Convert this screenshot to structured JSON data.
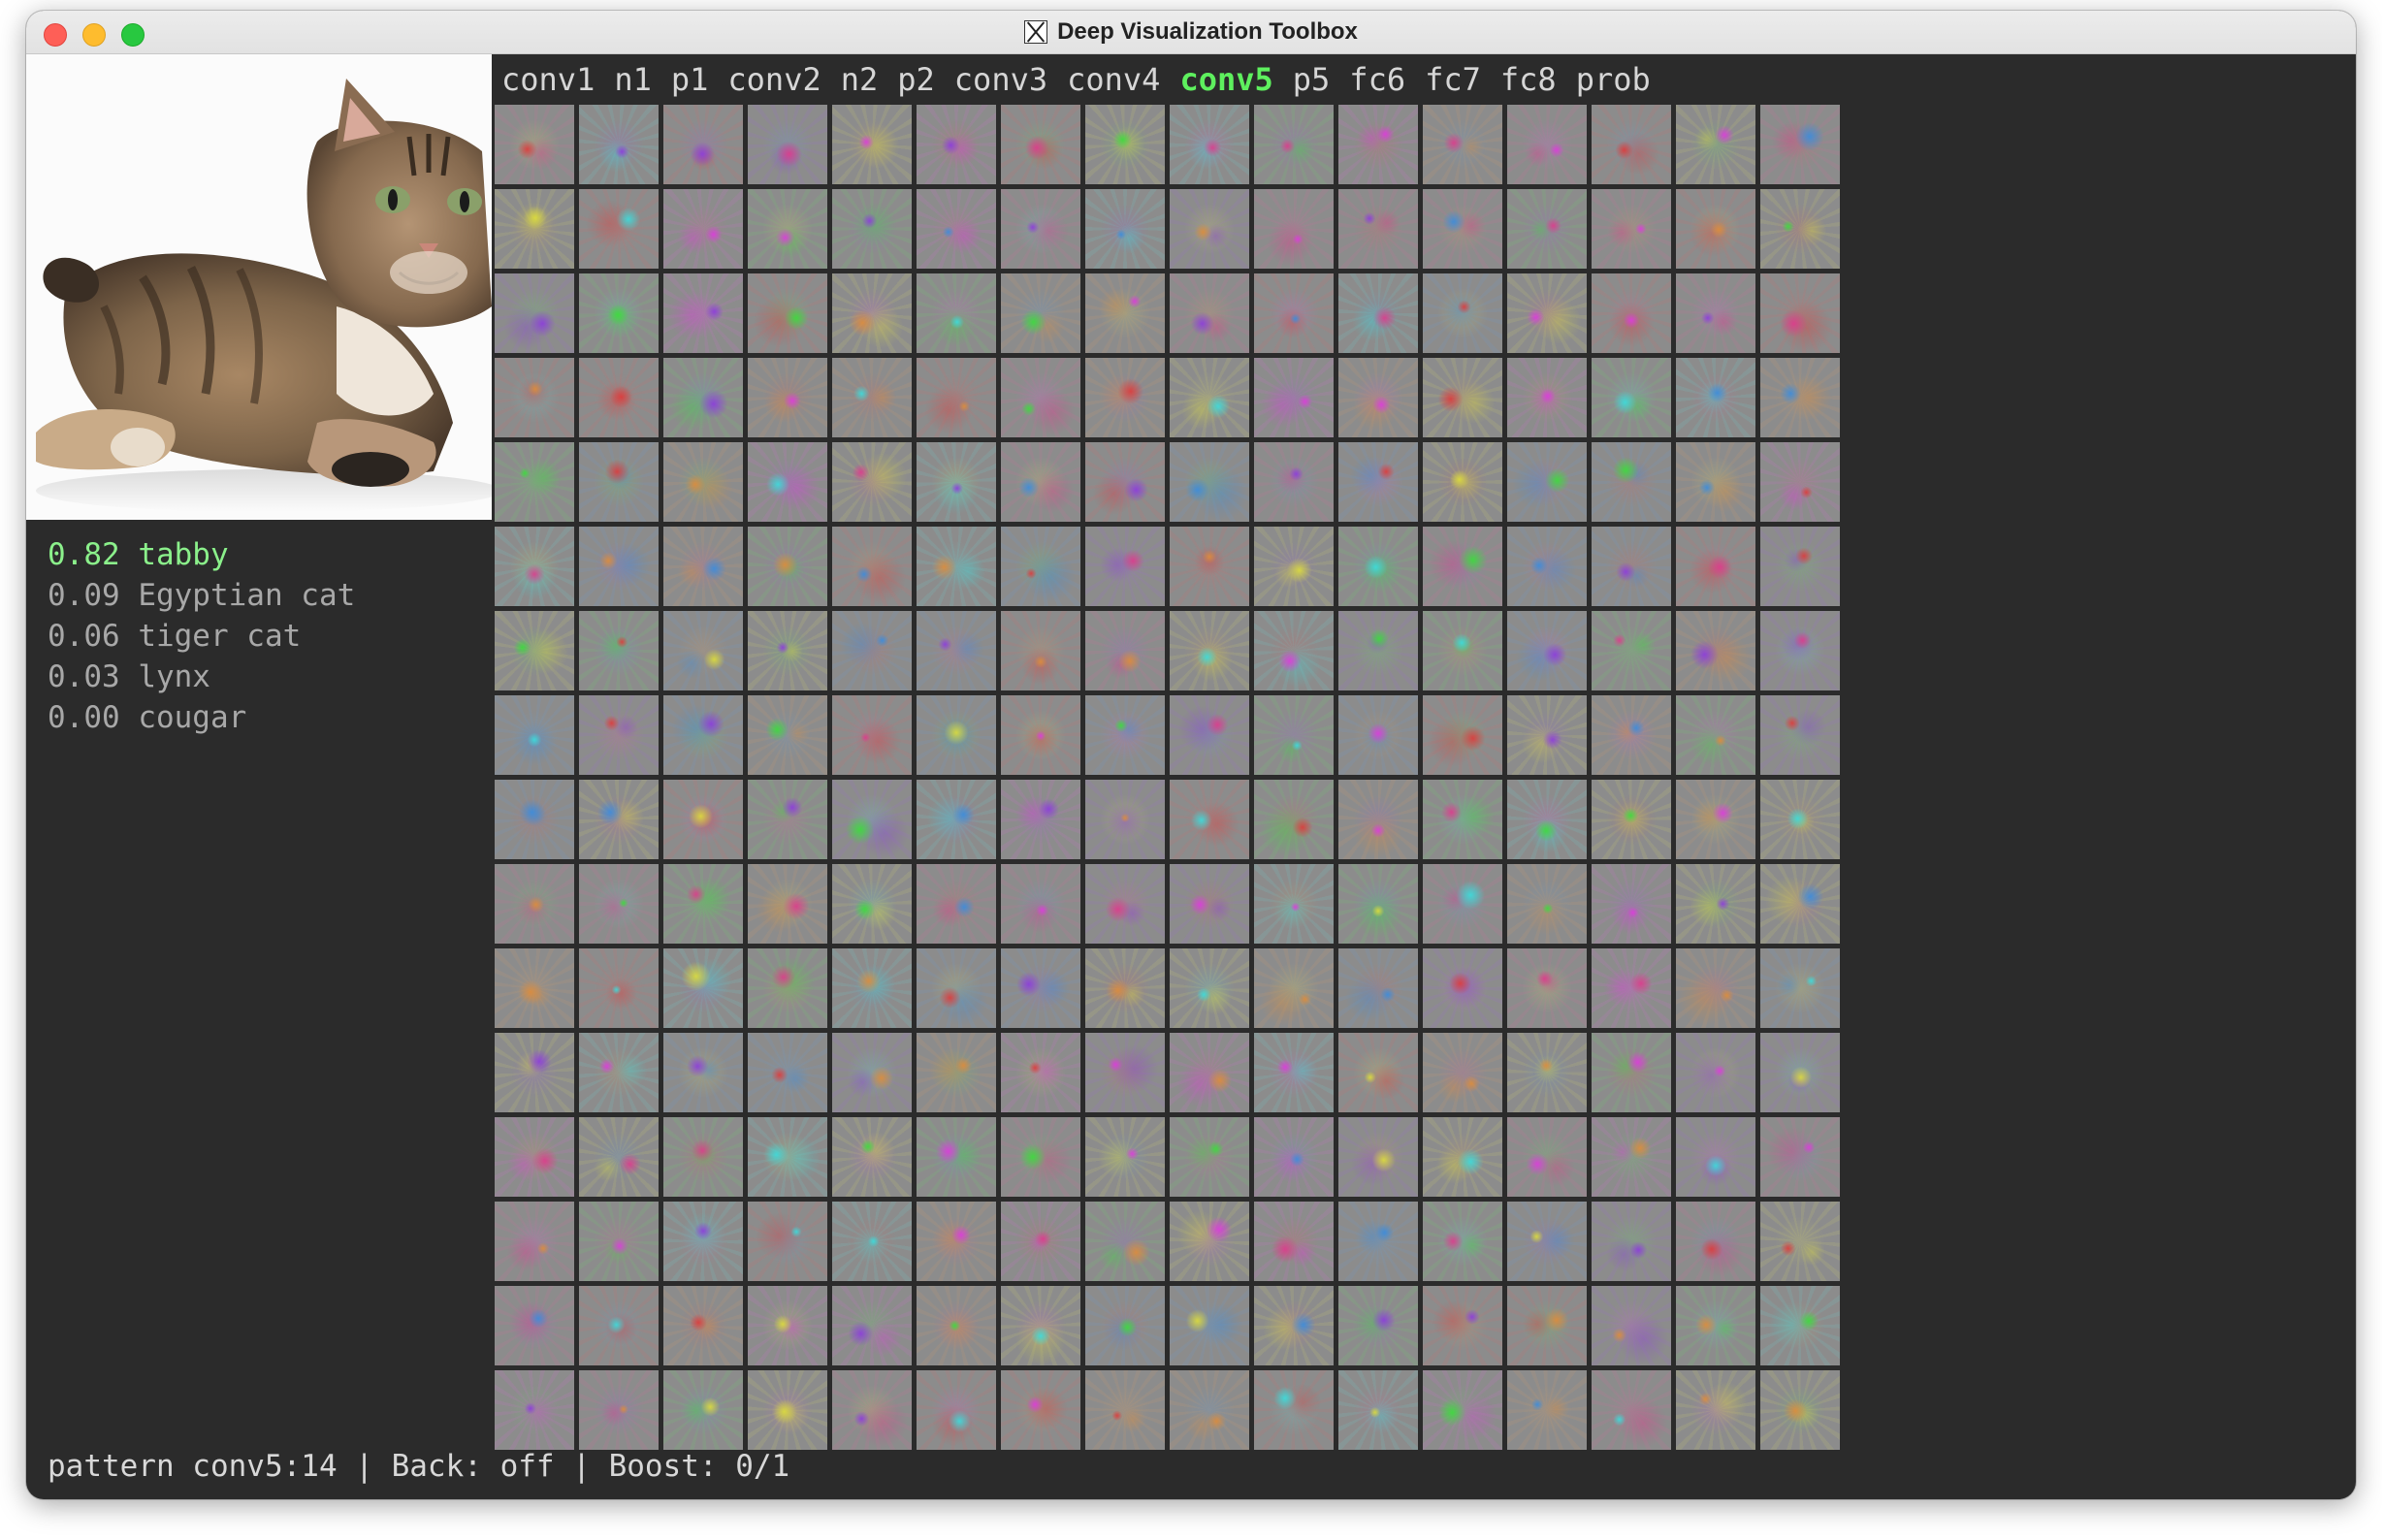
{
  "window": {
    "title": "Deep Visualization Toolbox"
  },
  "predictions": [
    {
      "text": "0.82 tabby"
    },
    {
      "text": "0.09 Egyptian cat"
    },
    {
      "text": "0.06 tiger cat"
    },
    {
      "text": "0.03 lynx"
    },
    {
      "text": "0.00 cougar"
    }
  ],
  "layers": [
    "conv1",
    "n1",
    "p1",
    "conv2",
    "n2",
    "p2",
    "conv3",
    "conv4",
    "conv5",
    "p5",
    "fc6",
    "fc7",
    "fc8",
    "prob"
  ],
  "active_layer": "conv5",
  "grid": {
    "rows": 16,
    "cols": 16,
    "cell_color": "#8c8c8c"
  },
  "status": {
    "text": "pattern conv5:14 | Back: off | Boost: 0/1"
  },
  "colors": {
    "background": "#2b2b2b",
    "active_layer": "#5ef05e",
    "top_prediction": "#8bf08b",
    "text": "#a8a8a8"
  }
}
